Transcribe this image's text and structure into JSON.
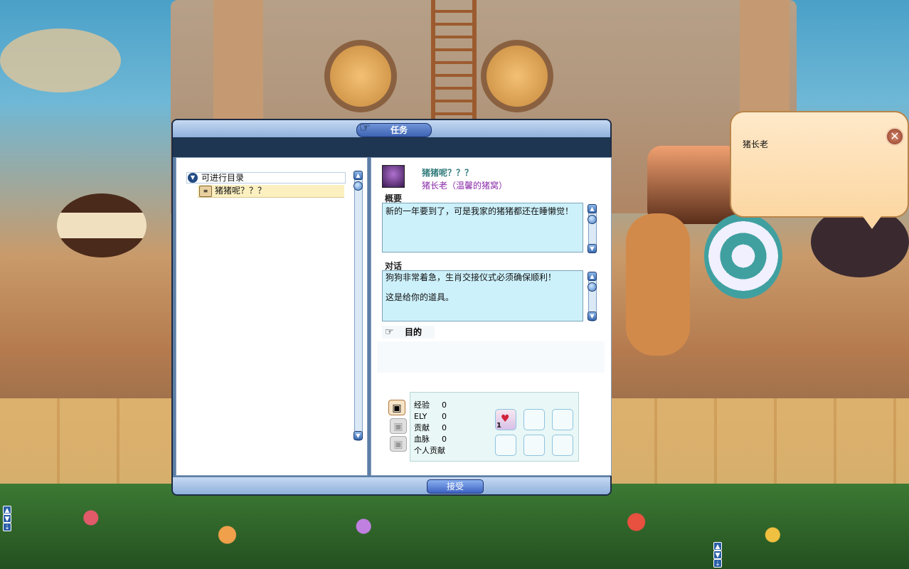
{
  "dialog": {
    "title": "任务",
    "accept_label": "接受"
  },
  "quest_list": {
    "category": "可进行目录",
    "items": [
      {
        "label": "猪猪呢？？？"
      }
    ]
  },
  "quest_detail": {
    "quest_title": "猪猪呢？？？",
    "npc_line": "猪长老（温馨的猪窝）",
    "summary_label": "概要",
    "summary_text": "新的一年要到了，可是我家的猪猪都还在睡懒觉！",
    "dialog_label": "对话",
    "dialog_lines": [
      "狗狗非常着急，生肖交接仪式必须确保顺利！",
      "这是给你的道具。"
    ],
    "goal_label": "目的"
  },
  "rewards": {
    "rows": [
      {
        "label": "经验",
        "value": "0"
      },
      {
        "label": "ELY",
        "value": "0"
      },
      {
        "label": "贡献",
        "value": "0"
      },
      {
        "label": "血脉",
        "value": "0"
      },
      {
        "label": "个人贡献",
        "value": ""
      }
    ],
    "item_count": "1"
  },
  "npc_bubble": {
    "name": "猪长老"
  },
  "colors": {
    "accent": "#3d63b3",
    "quest_title": "#2f7a7a",
    "npc_line": "#8a2aa8",
    "textbox_bg": "#cdf1fb"
  }
}
